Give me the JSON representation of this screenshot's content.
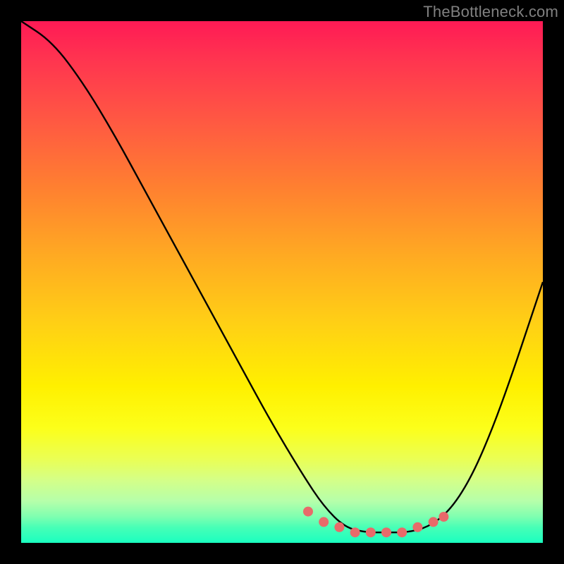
{
  "watermark": "TheBottleneck.com",
  "colors": {
    "frame": "#000000",
    "curve": "#000000",
    "marker": "#e86a6a",
    "gradient_top": "#ff1a55",
    "gradient_bottom": "#1affc0"
  },
  "chart_data": {
    "type": "line",
    "title": "",
    "xlabel": "",
    "ylabel": "",
    "xlim": [
      0,
      100
    ],
    "ylim": [
      0,
      100
    ],
    "series": [
      {
        "name": "bottleneck-curve",
        "x": [
          0,
          6,
          12,
          18,
          24,
          30,
          36,
          42,
          48,
          54,
          58,
          62,
          66,
          70,
          74,
          78,
          82,
          86,
          90,
          94,
          98,
          100
        ],
        "y": [
          100,
          96,
          88,
          78,
          67,
          56,
          45,
          34,
          23,
          13,
          7,
          3,
          2,
          2,
          2,
          3,
          6,
          12,
          21,
          32,
          44,
          50
        ]
      }
    ],
    "markers": {
      "name": "highlight-dots",
      "x": [
        55,
        58,
        61,
        64,
        67,
        70,
        73,
        76,
        79,
        81
      ],
      "y": [
        6,
        4,
        3,
        2,
        2,
        2,
        2,
        3,
        4,
        5
      ]
    },
    "annotations": []
  }
}
